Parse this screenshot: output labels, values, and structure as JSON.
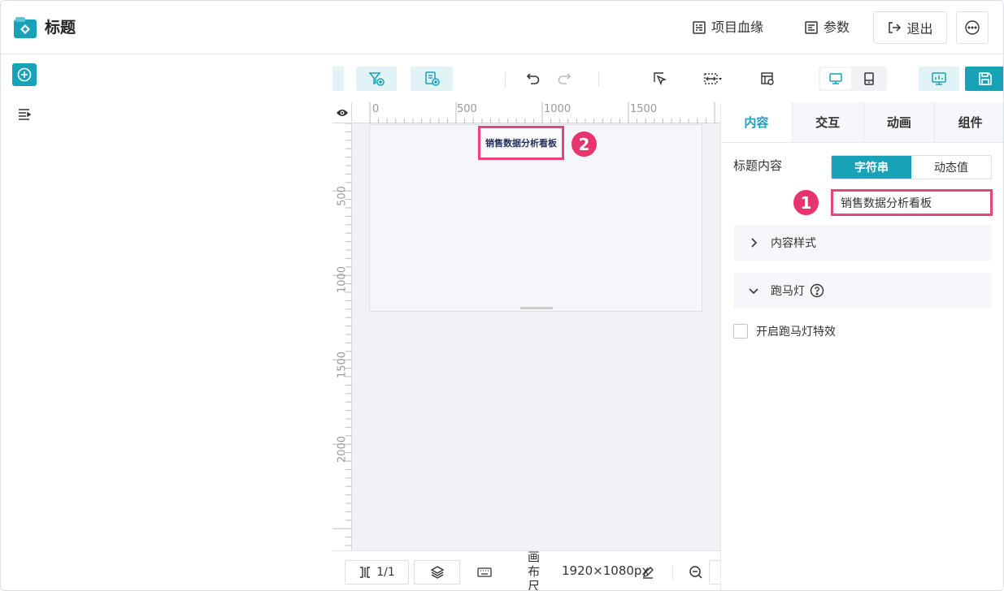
{
  "header": {
    "title": "标题",
    "lineage_label": "项目血缘",
    "params_label": "参数",
    "exit_label": "退出"
  },
  "ruler": {
    "top_labels": [
      "0",
      "500",
      "1000",
      "1500"
    ],
    "left_labels": [
      "500",
      "1000",
      "1500",
      "2000"
    ]
  },
  "canvas": {
    "title_text": "销售数据分析看板"
  },
  "badges": {
    "first": "1",
    "second": "2"
  },
  "bottombar": {
    "page_indicator": "1/1",
    "canvas_size_label": "画布尺寸:",
    "canvas_size_value": "1920×1080px"
  },
  "panel": {
    "tabs": [
      "内容",
      "交互",
      "动画",
      "组件"
    ],
    "active_tab": "内容",
    "title_content_label": "标题内容",
    "toggle_string": "字符串",
    "toggle_dynamic": "动态值",
    "title_input_value": "销售数据分析看板",
    "content_style_label": "内容样式",
    "marquee_label": "跑马灯",
    "marquee_checkbox_label": "开启跑马灯特效"
  },
  "colors": {
    "accent": "#17a2b8",
    "highlight": "#e8447b",
    "badge": "#e8336e"
  }
}
